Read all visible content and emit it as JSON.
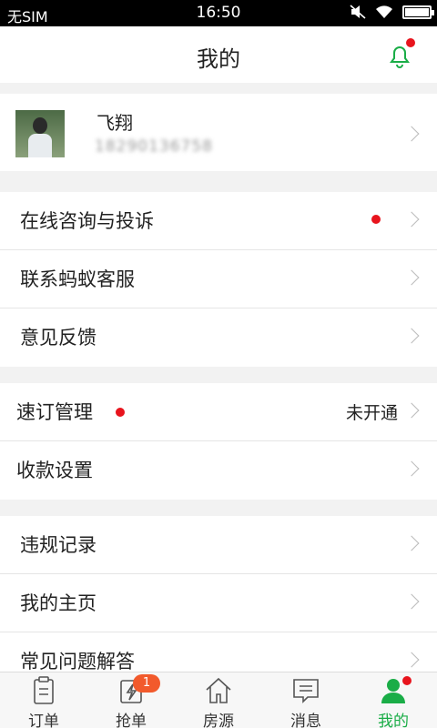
{
  "status_bar": {
    "carrier": "无SIM",
    "time": "16:50",
    "battery_level": 1.0
  },
  "header": {
    "title": "我的",
    "bell_icon": "bell-icon",
    "has_notification": true
  },
  "profile": {
    "name": "飞翔",
    "phone": "18290136758"
  },
  "menu_group_1": [
    {
      "label": "在线咨询与投诉",
      "has_dot": true
    },
    {
      "label": "联系蚂蚁客服"
    },
    {
      "label": "意见反馈"
    }
  ],
  "menu_group_2": [
    {
      "label": "速订管理",
      "value": "未开通",
      "has_dot": true
    },
    {
      "label": "收款设置"
    }
  ],
  "menu_group_3": [
    {
      "label": "违规记录"
    },
    {
      "label": "我的主页"
    },
    {
      "label": "常见问题解答"
    }
  ],
  "tabbar": {
    "items": [
      {
        "label": "订单",
        "icon": "clipboard-icon"
      },
      {
        "label": "抢单",
        "icon": "lightning-icon",
        "badge": "1"
      },
      {
        "label": "房源",
        "icon": "house-icon"
      },
      {
        "label": "消息",
        "icon": "message-icon"
      },
      {
        "label": "我的",
        "icon": "person-icon",
        "active": true,
        "has_dot": true
      }
    ]
  },
  "colors": {
    "accent": "#1aad47",
    "dot": "#e8141d",
    "badge": "#f25a2c"
  }
}
